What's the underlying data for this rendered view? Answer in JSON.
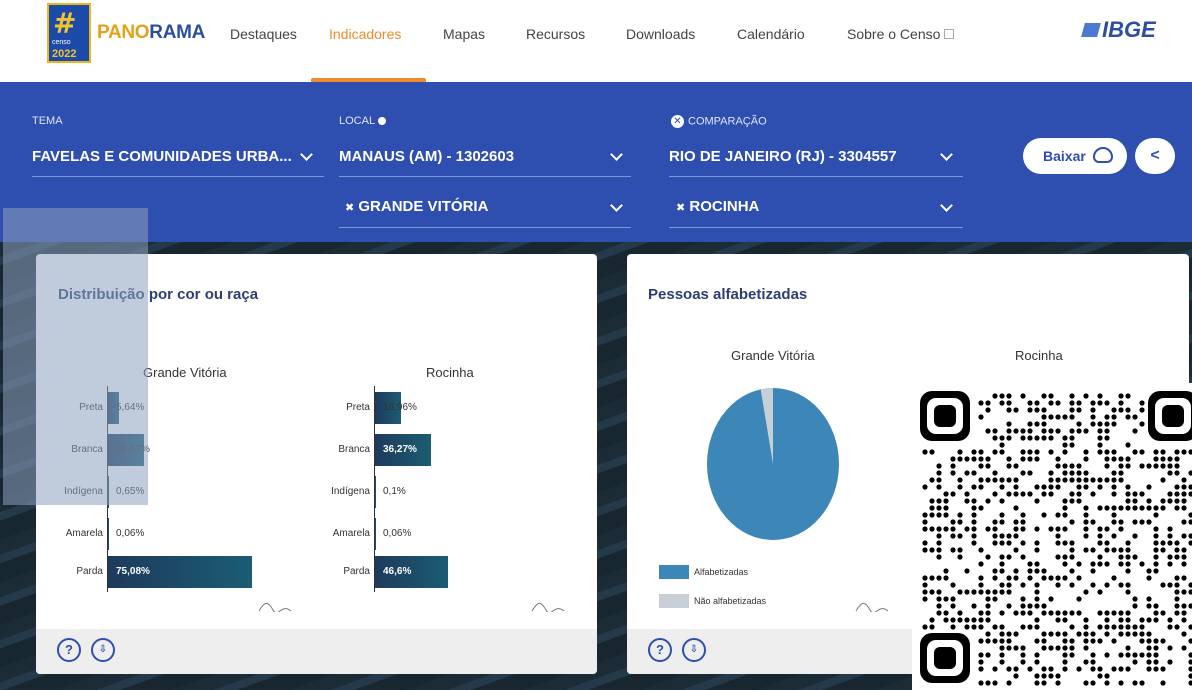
{
  "nav": {
    "logo_censo": "censo",
    "logo_year": "2022",
    "brand_part1": "PANO",
    "brand_part2": "RAMA",
    "items": [
      "Destaques",
      "Indicadores",
      "Mapas",
      "Recursos",
      "Downloads",
      "Calendário",
      "Sobre o Censo"
    ],
    "active_item": "Indicadores",
    "ibge": "IBGE"
  },
  "filters": {
    "tema_label": "TEMA",
    "tema_value": "FAVELAS E COMUNIDADES URBA...",
    "local_label": "LOCAL",
    "local_value": "MANAUS (AM) - 1302603",
    "local_value2": "GRANDE VITÓRIA",
    "comparacao_label": "COMPARAÇÃO",
    "comparacao_value": "RIO DE JANEIRO (RJ) - 3304557",
    "comparacao_value2": "ROCINHA",
    "remove_symbol": "✖",
    "baixar_label": "Baixar"
  },
  "card1": {
    "title": "Distribuição por cor ou raça",
    "left": {
      "subtitle": "Grande Vitória",
      "bars": [
        {
          "label": "Preta",
          "value": "5,64%",
          "pct": 5.64
        },
        {
          "label": "Branca",
          "value": "18,57%",
          "pct": 18.57
        },
        {
          "label": "Indígena",
          "value": "0,65%",
          "pct": 0.65
        },
        {
          "label": "Amarela",
          "value": "0,06%",
          "pct": 0.06
        },
        {
          "label": "Parda",
          "value": "75,08%",
          "pct": 75.08
        }
      ]
    },
    "right": {
      "subtitle": "Rocinha",
      "bars": [
        {
          "label": "Preta",
          "value": "16,96%",
          "pct": 16.96
        },
        {
          "label": "Branca",
          "value": "36,27%",
          "pct": 36.27
        },
        {
          "label": "Indígena",
          "value": "0,1%",
          "pct": 0.1
        },
        {
          "label": "Amarela",
          "value": "0,06%",
          "pct": 0.06
        },
        {
          "label": "Parda",
          "value": "46,6%",
          "pct": 46.6
        }
      ]
    },
    "help_symbol": "?"
  },
  "card2": {
    "title": "Pessoas alfabetizadas",
    "subtitle_left": "Grande Vitória",
    "subtitle_right": "Rocinha",
    "legend": [
      "Alfabetizadas",
      "Não alfabetizadas"
    ],
    "pie_alfabetizadas_share": 0.97,
    "help_symbol": "?"
  },
  "colors": {
    "primary_blue": "#2f4fb0",
    "active_orange": "#f08a2c",
    "bar": "#1e3a5c",
    "pie_main": "#3d86b8",
    "pie_rest": "#c8ced6"
  }
}
